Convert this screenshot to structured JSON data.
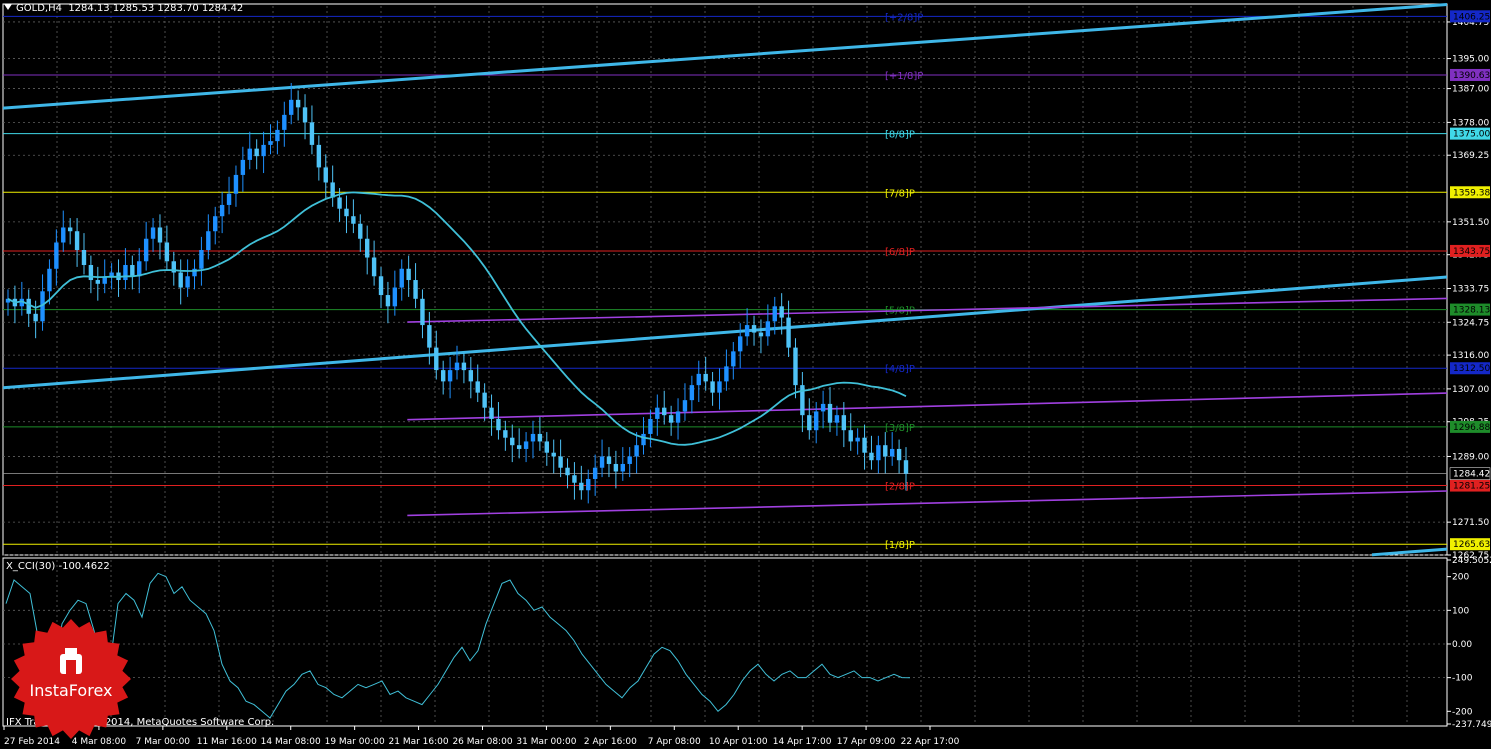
{
  "window": {
    "symbol_label": "GOLD,H4",
    "ohlc": "1284.13 1285.53 1283.70 1284.42"
  },
  "indicator": {
    "title": "X_CCI(30) -100.4622"
  },
  "copyright": "IFX Trader, © 2001-2014, MetaQuotes Software Corp.",
  "logo": {
    "text": "InstaForex"
  },
  "colors": {
    "background": "#000000",
    "bull": "#1e90ff",
    "bear": "#4fc3f7",
    "ma": "#40c0d8",
    "channel": "#3fb7e8",
    "purple": "#a040e0",
    "cci": "#40c0d8",
    "grid": "#606060"
  },
  "chart_data": [
    {
      "type": "candlestick",
      "symbol": "GOLD",
      "timeframe": "H4",
      "ylim": [
        1262.75,
        1409.0
      ],
      "y_ticks": [
        1404.75,
        1395.0,
        1387.0,
        1378.0,
        1369.25,
        1351.5,
        1342.75,
        1333.75,
        1324.75,
        1316.0,
        1307.0,
        1298.25,
        1289.0,
        1271.5,
        1262.75
      ],
      "x_ticks": [
        "27 Feb 2014",
        "4 Mar 08:00",
        "7 Mar 00:00",
        "11 Mar 16:00",
        "14 Mar 08:00",
        "19 Mar 00:00",
        "21 Mar 16:00",
        "26 Mar 08:00",
        "31 Mar 00:00",
        "2 Apr 16:00",
        "7 Apr 08:00",
        "10 Apr 01:00",
        "14 Apr 17:00",
        "17 Apr 09:00",
        "22 Apr 17:00"
      ],
      "current_price": 1284.42,
      "murrey_levels": [
        {
          "price": 1406.25,
          "label": "[+2/8]P",
          "price_label": "1406.25",
          "color": "#1428c8"
        },
        {
          "price": 1390.63,
          "label": "[+1/8]P",
          "price_label": "1390.63",
          "color": "#8030c0"
        },
        {
          "price": 1375.0,
          "label": "[8/8]P",
          "price_label": "1375.00",
          "color": "#40d8e8"
        },
        {
          "price": 1359.38,
          "label": "[7/8]P",
          "price_label": "1359.38",
          "color": "#f0f000"
        },
        {
          "price": 1343.75,
          "label": "[6/8]P",
          "price_label": "1343.75",
          "color": "#e02020"
        },
        {
          "price": 1328.13,
          "label": "[5/8]P",
          "price_label": "1328.13",
          "color": "#1e8c2a"
        },
        {
          "price": 1312.5,
          "label": "[4/8]P",
          "price_label": "1312.50",
          "color": "#1428c8"
        },
        {
          "price": 1296.88,
          "label": "[3/8]P",
          "price_label": "1296.88",
          "color": "#1e8c2a"
        },
        {
          "price": 1281.25,
          "label": "[2/8]P",
          "price_label": "1281.25",
          "color": "#e02020"
        },
        {
          "price": 1265.63,
          "label": "[1/8]P",
          "price_label": "1265.63",
          "color": "#f0f000"
        }
      ],
      "closes": [
        1331,
        1329,
        1331,
        1327,
        1325,
        1333,
        1339,
        1346,
        1350,
        1349,
        1344,
        1340,
        1336,
        1335,
        1337,
        1338,
        1336,
        1340,
        1337,
        1341,
        1347,
        1350,
        1346,
        1341,
        1338,
        1334,
        1337,
        1339,
        1344,
        1349,
        1353,
        1356,
        1359,
        1364,
        1368,
        1371,
        1369,
        1372,
        1373,
        1376,
        1380,
        1384,
        1382,
        1378,
        1372,
        1366,
        1362,
        1358,
        1355,
        1353,
        1351,
        1347,
        1342,
        1337,
        1332,
        1329,
        1334,
        1339,
        1336,
        1331,
        1324,
        1318,
        1312,
        1309,
        1312,
        1314,
        1312,
        1309,
        1306,
        1302,
        1299,
        1296,
        1294,
        1292,
        1291,
        1293,
        1295,
        1293,
        1290,
        1289,
        1286,
        1284,
        1282,
        1280,
        1283,
        1286,
        1289,
        1287,
        1285,
        1287,
        1289,
        1292,
        1295,
        1299,
        1302,
        1300,
        1298,
        1301,
        1304,
        1308,
        1311,
        1309,
        1306,
        1309,
        1313,
        1317,
        1321,
        1324,
        1322,
        1321,
        1325,
        1329,
        1326,
        1318,
        1308,
        1300,
        1296,
        1301,
        1303,
        1298,
        1300,
        1296,
        1293,
        1294,
        1290,
        1288,
        1292,
        1289,
        1291,
        1288,
        1284.42
      ],
      "ma_period": 30,
      "trend_lines": [
        {
          "name": "channel-upper",
          "p1": [
            0,
            1381.8
          ],
          "p2": [
            1,
            1409.4
          ]
        },
        {
          "name": "channel-middle",
          "p1": [
            0,
            1307.3
          ],
          "p2": [
            1,
            1336.8
          ]
        },
        {
          "name": "channel-lower",
          "p1": [
            0.948,
            1262.8
          ],
          "p2": [
            1,
            1264.3
          ]
        }
      ],
      "pitchfork_lines": [
        {
          "name": "pitch-upper",
          "p1": [
            0.28,
            1324.8
          ],
          "p2": [
            1,
            1331.1
          ]
        },
        {
          "name": "pitch-middle",
          "p1": [
            0.28,
            1298.8
          ],
          "p2": [
            1,
            1305.9
          ]
        },
        {
          "name": "pitch-lower",
          "p1": [
            0.28,
            1273.3
          ],
          "p2": [
            1,
            1279.8
          ]
        }
      ]
    },
    {
      "type": "line",
      "name": "X_CCI(30)",
      "ylim": [
        -237.7497,
        249.5052
      ],
      "y_ticks": [
        249.5052,
        200,
        100,
        0.0,
        -100,
        -200,
        -237.7497
      ],
      "tick_labels": [
        "249.5052",
        "200",
        "100",
        "0.00",
        "-100",
        "-200",
        "-237.7497"
      ],
      "current_value": -100.4622,
      "values": [
        120,
        190,
        170,
        150,
        20,
        -40,
        -90,
        60,
        100,
        130,
        120,
        40,
        -60,
        -60,
        120,
        150,
        130,
        80,
        180,
        210,
        200,
        150,
        170,
        130,
        110,
        90,
        40,
        -60,
        -110,
        -130,
        -170,
        -180,
        -200,
        -220,
        -180,
        -140,
        -120,
        -90,
        -80,
        -120,
        -130,
        -150,
        -160,
        -140,
        -120,
        -130,
        -120,
        -110,
        -150,
        -140,
        -160,
        -170,
        -180,
        -150,
        -120,
        -80,
        -40,
        -10,
        -50,
        -20,
        60,
        120,
        180,
        190,
        150,
        130,
        100,
        110,
        80,
        60,
        40,
        10,
        -30,
        -60,
        -90,
        -120,
        -140,
        -160,
        -130,
        -110,
        -70,
        -30,
        -10,
        -20,
        -50,
        -90,
        -120,
        -150,
        -170,
        -200,
        -180,
        -150,
        -110,
        -80,
        -60,
        -90,
        -110,
        -90,
        -80,
        -100,
        -100,
        -80,
        -60,
        -90,
        -100,
        -90,
        -80,
        -100,
        -100,
        -110,
        -100,
        -90,
        -100,
        -100.4622
      ]
    }
  ]
}
